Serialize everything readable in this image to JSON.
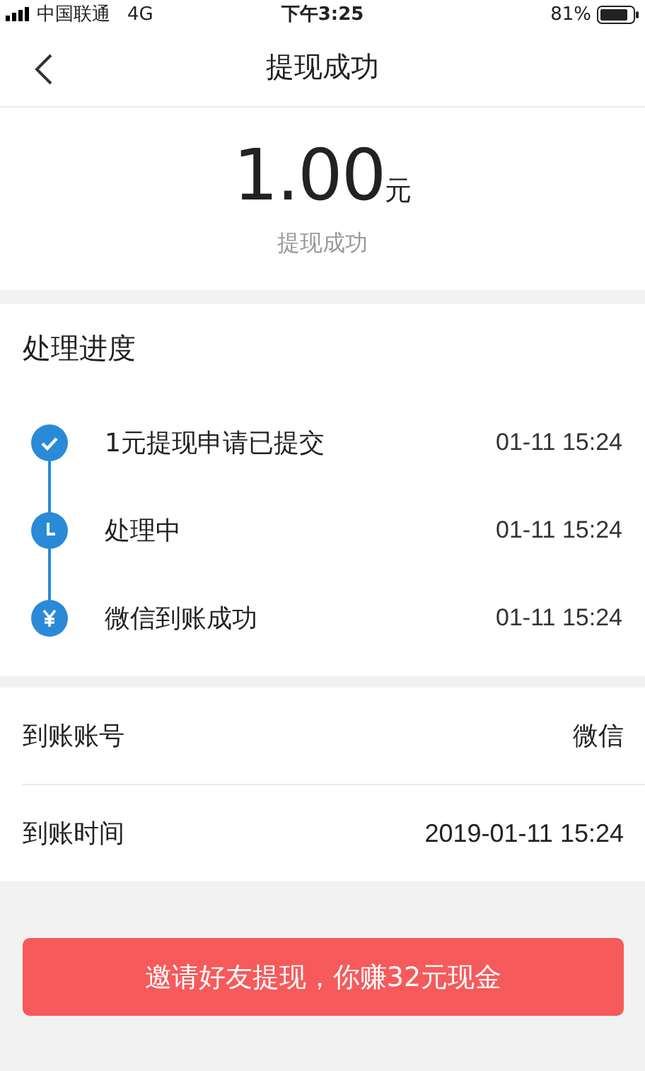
{
  "status_bar": {
    "carrier": "中国联通",
    "network": "4G",
    "time": "下午3:25",
    "battery": "81%"
  },
  "nav": {
    "title": "提现成功"
  },
  "amount": {
    "value": "1.00",
    "unit": "元",
    "status": "提现成功"
  },
  "progress": {
    "title": "处理进度",
    "steps": [
      {
        "kind": "check",
        "label": "1元提现申请已提交",
        "time": "01-11 15:24"
      },
      {
        "kind": "clock",
        "label": "处理中",
        "time": "01-11 15:24"
      },
      {
        "kind": "yen",
        "label": "微信到账成功",
        "time": "01-11 15:24"
      }
    ]
  },
  "details": [
    {
      "label": "到账账号",
      "value": "微信"
    },
    {
      "label": "到账时间",
      "value": "2019-01-11 15:24"
    }
  ],
  "invite_button": "邀请好友提现，你赚32元现金"
}
